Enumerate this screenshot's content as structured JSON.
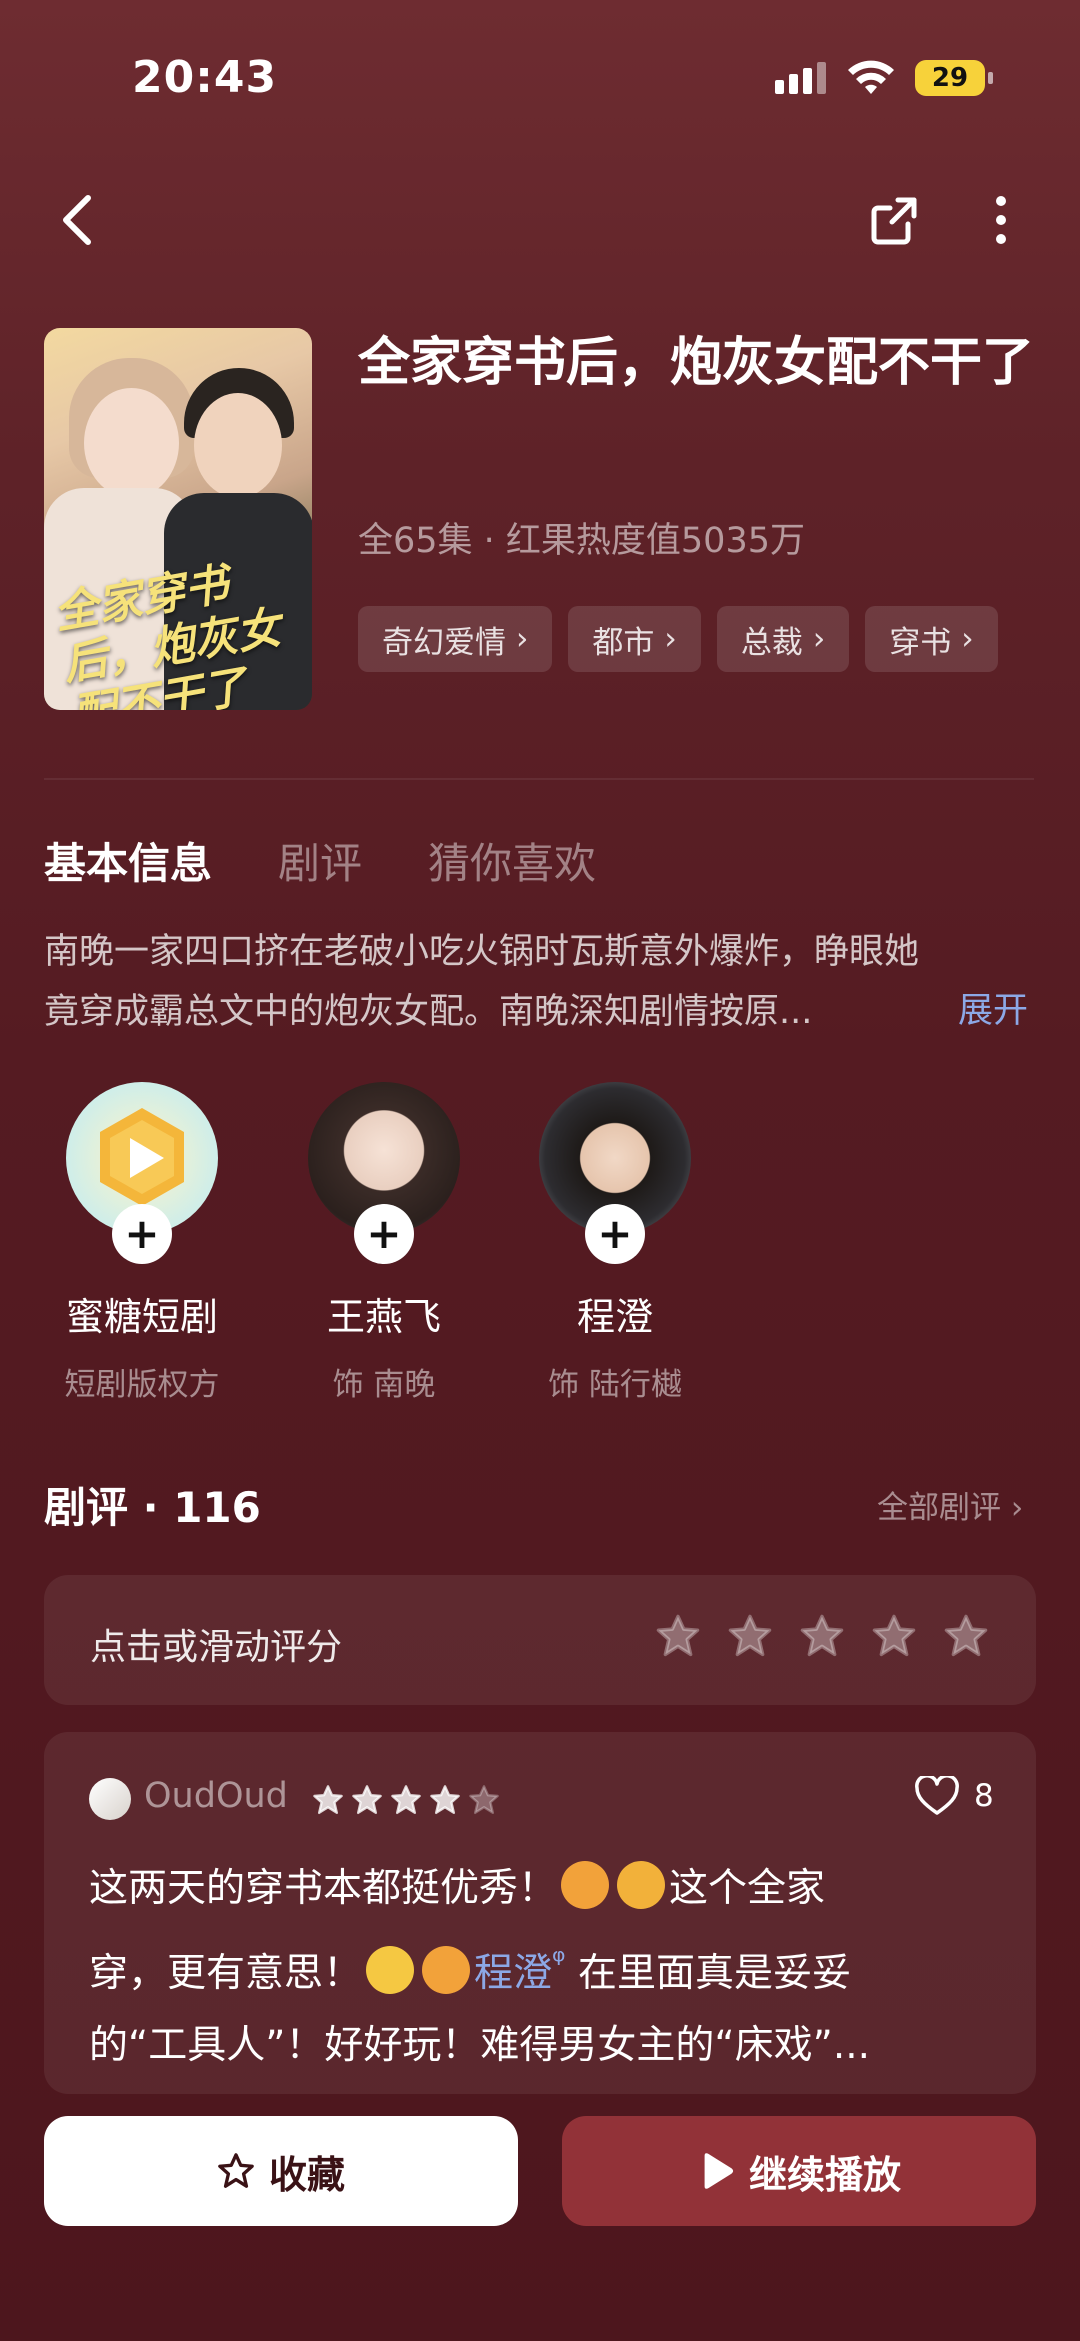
{
  "status_bar": {
    "time": "20:43",
    "battery": "29"
  },
  "nav": {
    "back_icon": "chevron-left-icon",
    "share_icon": "share-icon",
    "more_icon": "more-vertical-icon"
  },
  "drama": {
    "title": "全家穿书后，炮灰女配不干了",
    "meta": "全65集 · 红果热度值5035万",
    "tags": [
      "奇幻爱情",
      "都市",
      "总裁",
      "穿书"
    ]
  },
  "tabs": [
    "基本信息",
    "剧评",
    "猜你喜欢"
  ],
  "synopsis": {
    "line1": "南晚一家四口挤在老破小吃火锅时瓦斯意外爆炸，睁眼她",
    "line2": "竟穿成霸总文中的炮灰女配。南晚深知剧情按原...",
    "expand": "展开"
  },
  "people": [
    {
      "name": "蜜糖短剧",
      "role": "短剧版权方"
    },
    {
      "name": "王燕飞",
      "role": "饰 南晚"
    },
    {
      "name": "程澄",
      "role": "饰 陆行樾"
    }
  ],
  "reviews": {
    "header": "剧评 · 116",
    "all_link": "全部剧评",
    "rate_prompt": "点击或滑动评分",
    "rate_stars": 5,
    "item": {
      "username": "OudOud",
      "stars": 4,
      "likes": "8",
      "text_1": "这两天的穿书本都挺优秀！",
      "text_2": "这个全家",
      "text_3": "穿，更有意思！",
      "mention": "程澄",
      "text_4": "在里面真是妥妥",
      "text_5": "的“工具人”！好好玩！难得男女主的“床戏”..."
    }
  },
  "bottom": {
    "favorite": "收藏",
    "continue": "继续播放"
  }
}
